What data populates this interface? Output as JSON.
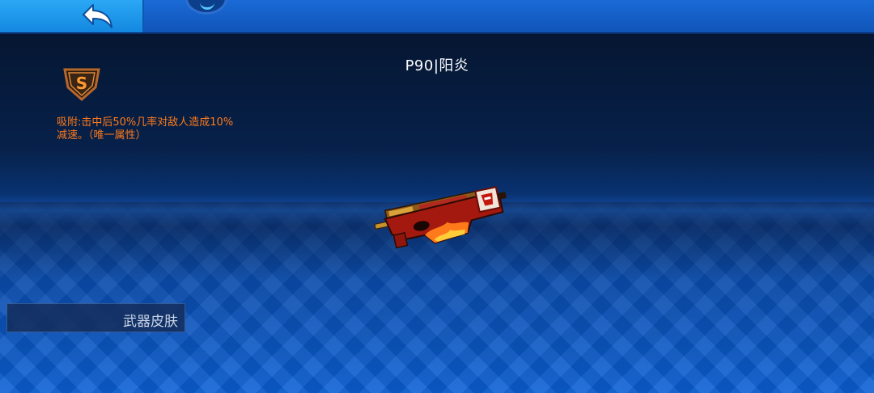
{
  "topbar": {
    "back_icon": "back-arrow-icon"
  },
  "weapon": {
    "name": "P90|阳炎",
    "rarity_badge": "S",
    "ability_description": "吸附:击中后50%几率对敌人造成10%减速。（唯一属性）",
    "image_icon": "p90-weapon-skin-icon"
  },
  "tabs": {
    "weapon_skins_label": "武器皮肤"
  },
  "colors": {
    "topbar": "#1563c8",
    "back_button": "#1e97ea",
    "ability_text": "#ff7a1a",
    "title_text": "#ffffff"
  }
}
